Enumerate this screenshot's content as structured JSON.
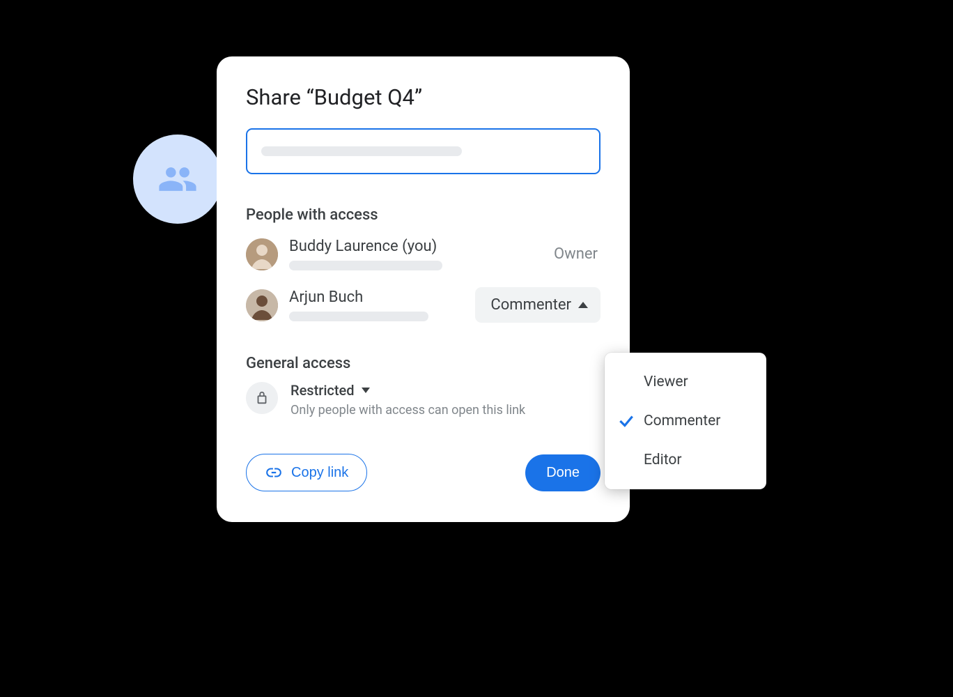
{
  "dialog": {
    "title": "Share “Budget Q4”",
    "people_heading": "People with access",
    "general_heading": "General access",
    "restricted_label": "Restricted",
    "restricted_desc": "Only people with access can open this link",
    "copy_link_label": "Copy link",
    "done_label": "Done"
  },
  "people": [
    {
      "name": "Buddy Laurence (you)",
      "role": "Owner"
    },
    {
      "name": "Arjun Buch",
      "role": "Commenter"
    }
  ],
  "role_menu": {
    "options": [
      "Viewer",
      "Commenter",
      "Editor"
    ],
    "selected": "Commenter"
  },
  "colors": {
    "primary": "#1a73e8",
    "badge_bg": "#d3e3fd"
  }
}
